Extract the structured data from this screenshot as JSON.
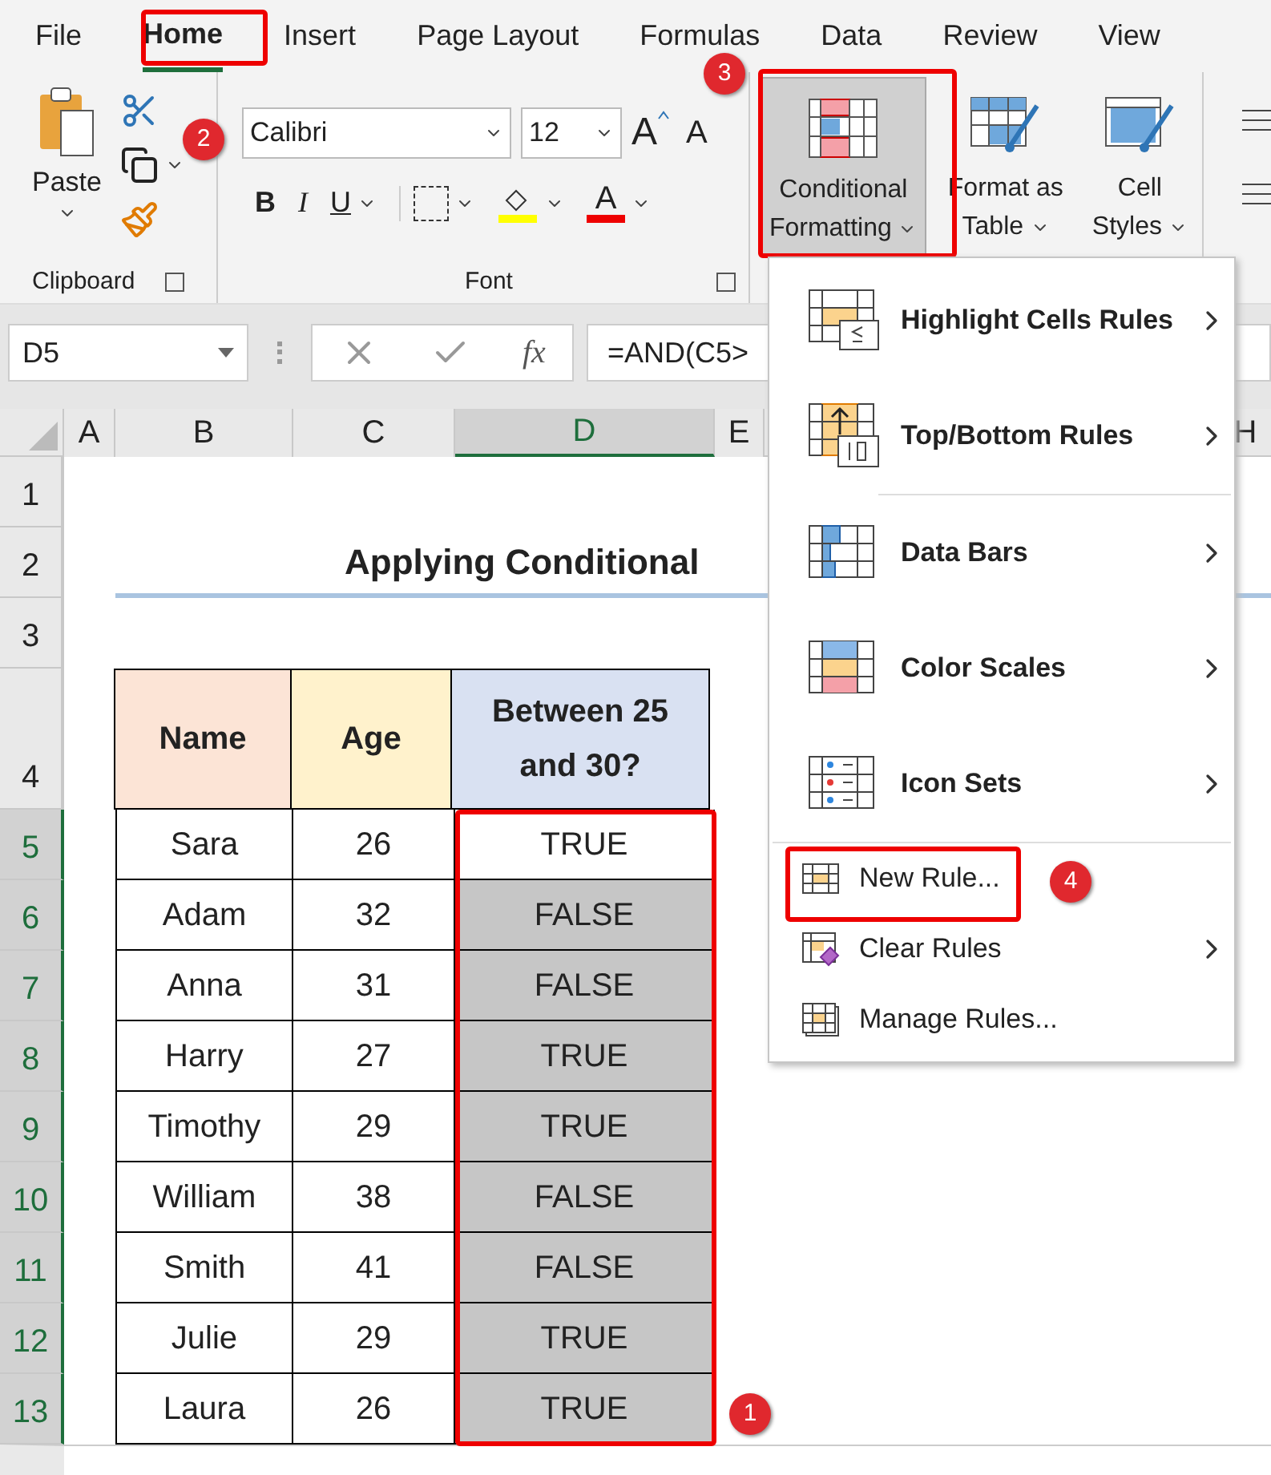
{
  "ribbon_tabs": [
    {
      "label": "File",
      "selected": false
    },
    {
      "label": "Home",
      "selected": true
    },
    {
      "label": "Insert",
      "selected": false
    },
    {
      "label": "Page Layout",
      "selected": false
    },
    {
      "label": "Formulas",
      "selected": false
    },
    {
      "label": "Data",
      "selected": false
    },
    {
      "label": "Review",
      "selected": false
    },
    {
      "label": "View",
      "selected": false
    }
  ],
  "clipboard": {
    "paste": "Paste",
    "group": "Clipboard"
  },
  "font": {
    "family": "Calibri",
    "size": "12",
    "grow": "A",
    "shrink": "A",
    "bold": "B",
    "italic": "I",
    "underline": "U",
    "font_color": "A",
    "group": "Font"
  },
  "styles": [
    {
      "lines": [
        "Conditional",
        "Formatting"
      ],
      "pressed": true
    },
    {
      "lines": [
        "Format as",
        "Table"
      ],
      "pressed": false
    },
    {
      "lines": [
        "Cell",
        "Styles"
      ],
      "pressed": false
    }
  ],
  "formula_bar": {
    "name_box": "D5",
    "fx": "fx",
    "formula": "=AND(C5>"
  },
  "columns": [
    {
      "label": "A",
      "selected": false
    },
    {
      "label": "B",
      "selected": false
    },
    {
      "label": "C",
      "selected": false
    },
    {
      "label": "D",
      "selected": true
    },
    {
      "label": "E",
      "selected": false
    },
    {
      "label": "H",
      "selected": false
    }
  ],
  "row_numbers": [
    {
      "label": "1",
      "selected": false
    },
    {
      "label": "2",
      "selected": false
    },
    {
      "label": "3",
      "selected": false
    },
    {
      "label": "4",
      "selected": false
    },
    {
      "label": "5",
      "selected": true
    },
    {
      "label": "6",
      "selected": true
    },
    {
      "label": "7",
      "selected": true
    },
    {
      "label": "8",
      "selected": true
    },
    {
      "label": "9",
      "selected": true
    },
    {
      "label": "10",
      "selected": true
    },
    {
      "label": "11",
      "selected": true
    },
    {
      "label": "12",
      "selected": true
    },
    {
      "label": "13",
      "selected": true
    }
  ],
  "title": "Applying Conditional",
  "table_headers": [
    {
      "label": "Name",
      "color": "#fce4d6"
    },
    {
      "label": "Age",
      "color": "#fff2cc"
    },
    {
      "label": "Between 25 and 30?",
      "color": "#d9e1f2"
    }
  ],
  "table_rows": [
    {
      "name": "Sara",
      "age": "26",
      "result": "TRUE",
      "active": true
    },
    {
      "name": "Adam",
      "age": "32",
      "result": "FALSE",
      "active": false
    },
    {
      "name": "Anna",
      "age": "31",
      "result": "FALSE",
      "active": false
    },
    {
      "name": "Harry",
      "age": "27",
      "result": "TRUE",
      "active": false
    },
    {
      "name": "Timothy",
      "age": "29",
      "result": "TRUE",
      "active": false
    },
    {
      "name": "William",
      "age": "38",
      "result": "FALSE",
      "active": false
    },
    {
      "name": "Smith",
      "age": "41",
      "result": "FALSE",
      "active": false
    },
    {
      "name": "Julie",
      "age": "29",
      "result": "TRUE",
      "active": false
    },
    {
      "name": "Laura",
      "age": "26",
      "result": "TRUE",
      "active": false
    }
  ],
  "menu": [
    {
      "kind": "rule",
      "label": "Highlight Cells Rules",
      "submenu": true
    },
    {
      "kind": "rule",
      "label": "Top/Bottom Rules",
      "submenu": true
    },
    {
      "kind": "rule",
      "label": "Data Bars",
      "submenu": true
    },
    {
      "kind": "rule",
      "label": "Color Scales",
      "submenu": true
    },
    {
      "kind": "rule",
      "label": "Icon Sets",
      "submenu": true
    },
    {
      "kind": "action",
      "label": "New Rule...",
      "submenu": false
    },
    {
      "kind": "action",
      "label": "Clear Rules",
      "submenu": true
    },
    {
      "kind": "action",
      "label": "Manage Rules...",
      "submenu": false
    }
  ],
  "step_badges": [
    "1",
    "2",
    "3",
    "4"
  ]
}
